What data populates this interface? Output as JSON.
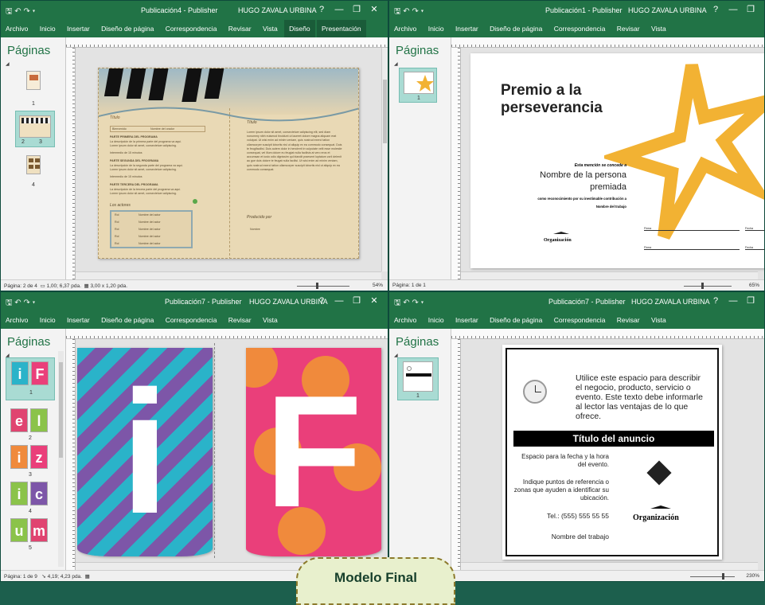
{
  "w1": {
    "title": "Publicación4 - Publisher",
    "user": "HUGO ZAVALA URBINA",
    "ribbon": [
      "Archivo",
      "Inicio",
      "Insertar",
      "Diseño de página",
      "Correspondencia",
      "Revisar",
      "Vista",
      "Diseño",
      "Presentación"
    ],
    "pages_title": "Páginas",
    "thumbs": [
      "1",
      "2",
      "3",
      "4"
    ],
    "status": "Página: 2 de 4",
    "status_pos": "1,00; 6,37 pda.",
    "status_size": "3,00 x 1,20 pda.",
    "zoom": "54%",
    "doc": {
      "titulo1": "Título",
      "titulo2": "Título",
      "line1": "Bienvenido",
      "line2": "Nombre del orador",
      "s1": "PARTE PRIMERA DEL PROGRAMA",
      "s1a": "La descripción de la primera parte del programa va aquí.",
      "s1b": "Lorem ipsum dolor sit amet, consectetuer adipiscing.",
      "s1c": "Intermedio de 15 minutos",
      "s2": "PARTE SEGUNDA DEL PROGRAMA",
      "s2a": "La descripción de la segunda parte del programa va aquí.",
      "s2b": "Lorem ipsum dolor sit amet, consectetuer adipiscing.",
      "s2c": "Intermedio de 15 minutos",
      "s3": "PARTE TERCERA DEL PROGRAMA",
      "s3a": "La descripción de la tercera parte del programa va aquí.",
      "s3b": "Lorem ipsum dolor sit amet, consectetuer adipiscing.",
      "actores": "Los actores",
      "rows": [
        [
          "Rol",
          "Nombre del actor"
        ],
        [
          "Rol",
          "Nombre del actor"
        ],
        [
          "Rol",
          "Nombre del actor"
        ],
        [
          "Rol",
          "Nombre del actor"
        ],
        [
          "Rol",
          "Nombre del actor"
        ]
      ],
      "body": "Lorem ipsum dolor sit amet, consectetuer adipiscing elit, sed diam nonummy nibh euismod tincidunt ut laoreet dolore magna aliquam erat volutpat. Ut wisi enim ad minim veniam, quis nostrud exerci tation ullamcorper suscipit lobortis nisl ut aliquip ex ea commodo consequat. Duis te feugifacilisi. Duis autem dolor in hendrerit in vulputate velit esse molestie consequat, vel illum dolore eu feugiat nulla facilisis at vero eros et accumsan et iusto odio dignissim qui blandit praesent luptatum zzril delenit au gue duis dolore te feugat nulla facilisi. Ut wisi enim ad minim veniam, quis nostrud exerci tation ullamcorper suscipit lobortis nisl ut aliquip ex ea commodo consequat.",
      "produccion": "Producido por",
      "nombre": "Nombre"
    }
  },
  "w2": {
    "title": "Publicación1 - Publisher",
    "user": "HUGO ZAVALA URBINA",
    "ribbon": [
      "Archivo",
      "Inicio",
      "Insertar",
      "Diseño de página",
      "Correspondencia",
      "Revisar",
      "Vista"
    ],
    "pages_title": "Páginas",
    "thumbs": [
      "1"
    ],
    "status": "Página: 1 de 1",
    "zoom": "65%",
    "doc": {
      "premio": "Premio a la perseverancia",
      "mencion": "Esta mención se concede a",
      "nombre": "Nombre de la persona premiada",
      "reconocimiento": "como reconocimiento por su inestimable contribución a",
      "trabajo": "Nombre del trabajo",
      "organizacion": "Organización",
      "firma1": "Firma",
      "fecha1": "Fecha",
      "firma2": "Firma",
      "fecha2": "Fecha"
    }
  },
  "w3": {
    "title": "Publicación7 - Publisher",
    "user": "HUGO ZAVALA URBINA",
    "ribbon": [
      "Archivo",
      "Inicio",
      "Insertar",
      "Diseño de página",
      "Correspondencia",
      "Revisar",
      "Vista"
    ],
    "pages_title": "Páginas",
    "thumbs": [
      "1",
      "2",
      "3",
      "4",
      "5"
    ],
    "thumb_letters": [
      [
        "i",
        "F"
      ],
      [
        "e",
        "l"
      ],
      [
        "i",
        "z"
      ],
      [
        "i",
        "c"
      ],
      [
        "u",
        "m"
      ]
    ],
    "status": "Página: 1 de 9",
    "status_pos": "4,19; 4,23 pda.",
    "doc": {
      "letter1": "i",
      "letter2": "F"
    }
  },
  "w4": {
    "title": "Publicación7 - Publisher",
    "user": "HUGO ZAVALA URBINA",
    "ribbon": [
      "Archivo",
      "Inicio",
      "Insertar",
      "Diseño de página",
      "Correspondencia",
      "Revisar",
      "Vista"
    ],
    "pages_title": "Páginas",
    "thumbs": [
      "1"
    ],
    "zoom": "230%",
    "doc": {
      "desc": "Utilice este espacio para describir el negocio, producto, servicio o evento. Este texto debe informarle al lector las ventajas de lo que ofrece.",
      "titulo": "Título del anuncio",
      "fecha": "Espacio para la fecha y la hora del evento.",
      "puntos": "Indique puntos de referencia o zonas que ayuden a identificar su ubicación.",
      "tel": "Tel.: (555) 555 55 55",
      "trabajo": "Nombre del trabajo",
      "organizacion": "Organización"
    }
  },
  "callout": "Modelo Final",
  "colors": {
    "accent": "#217346",
    "star": "#f2b233",
    "teal": "#2ab3c9",
    "purple": "#7d56a8",
    "pink": "#ea3f7a",
    "orange": "#f08a3c"
  }
}
